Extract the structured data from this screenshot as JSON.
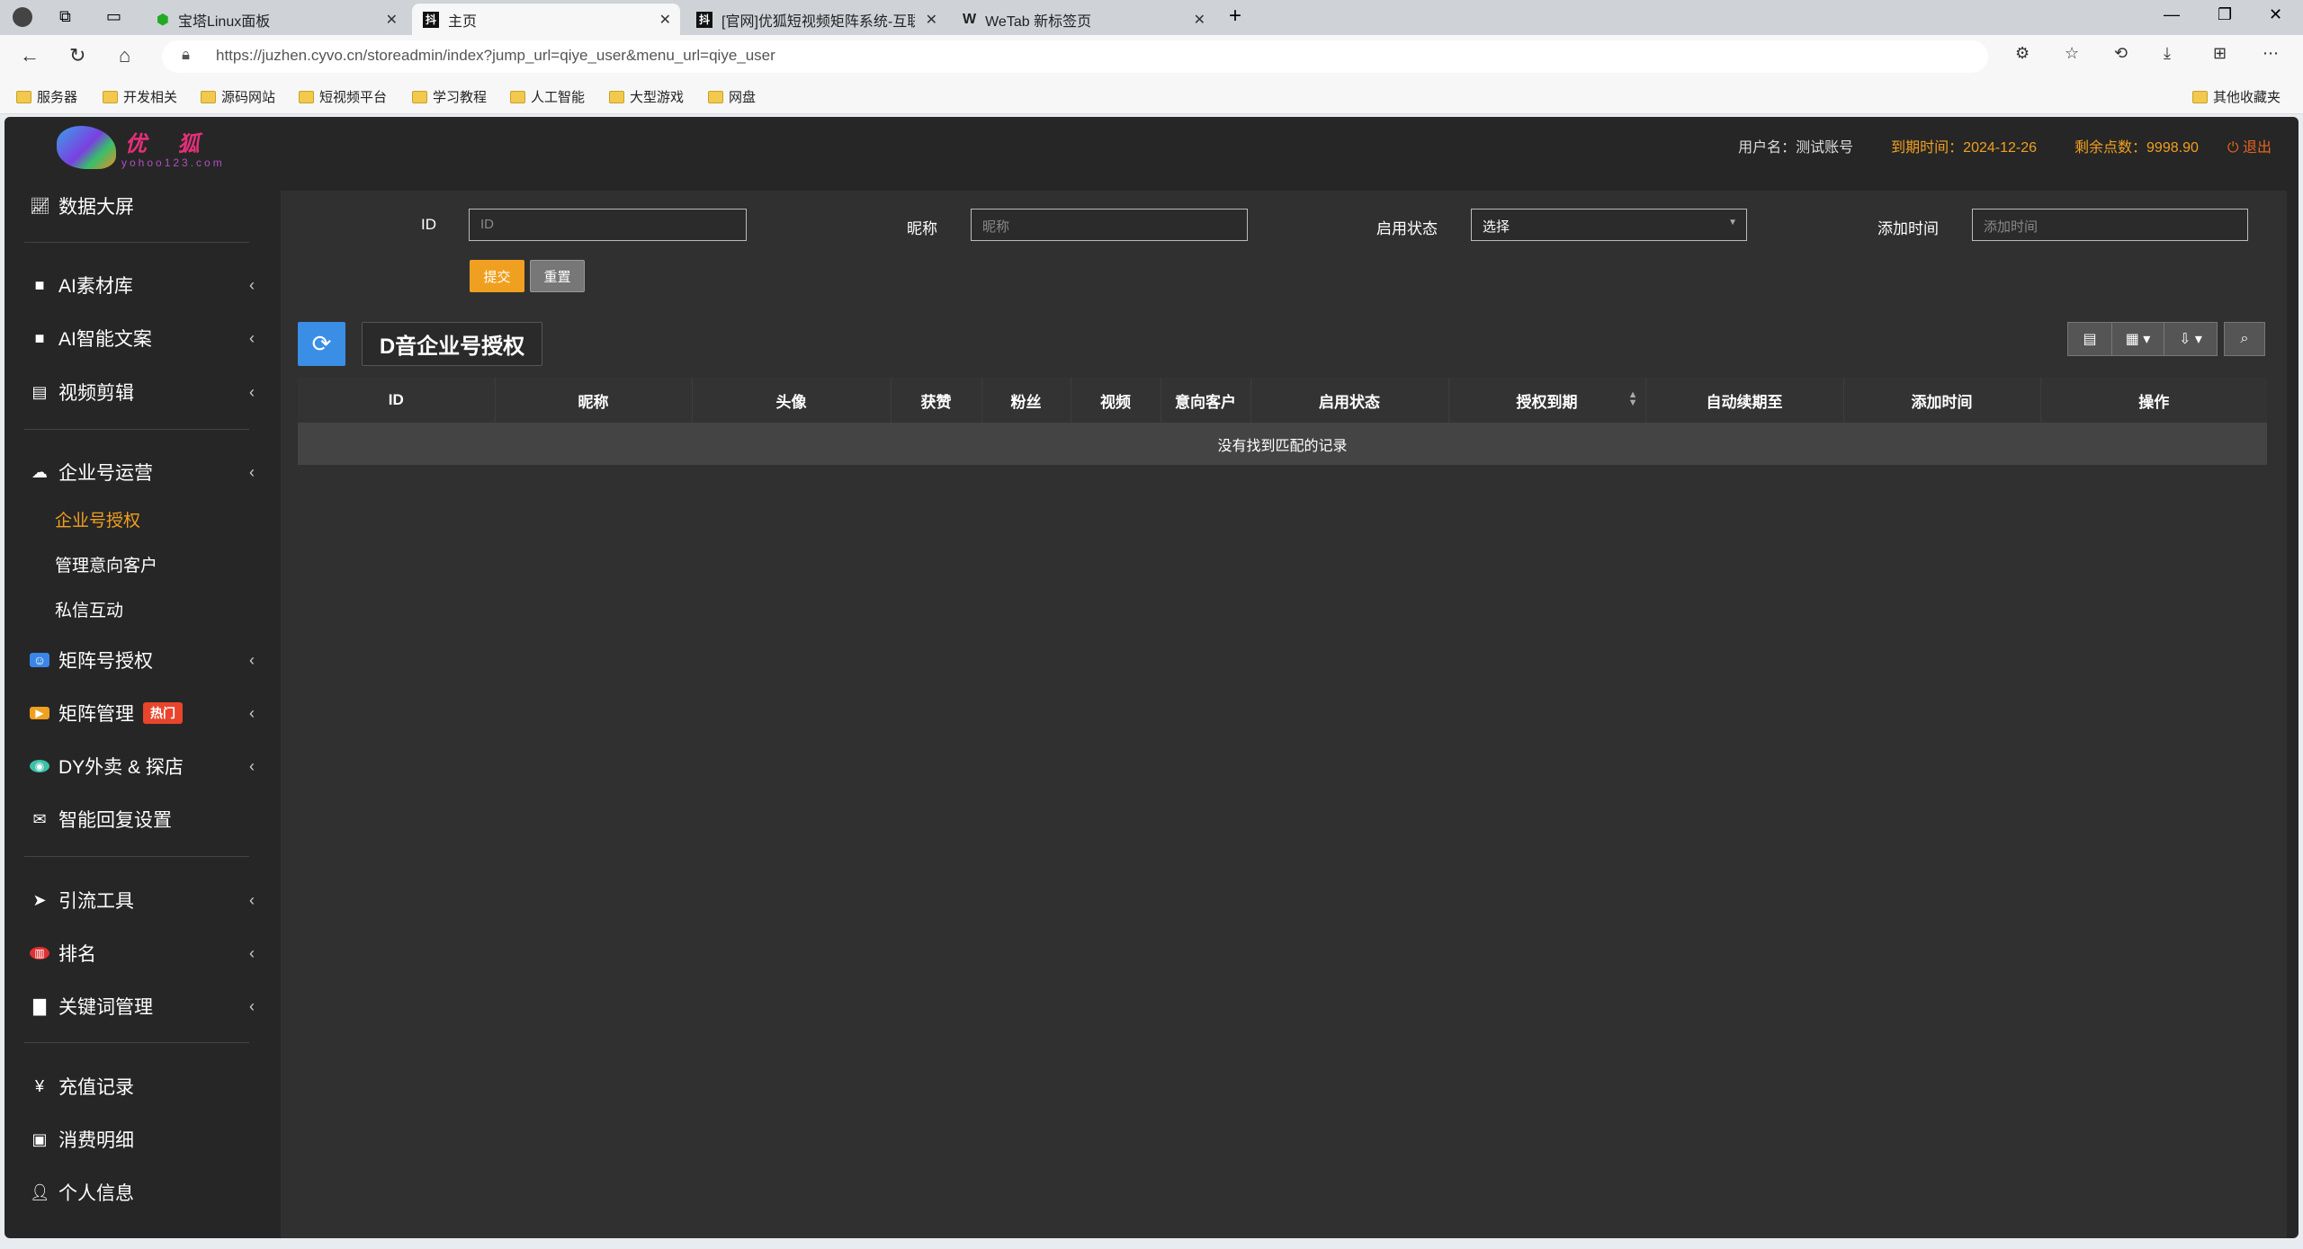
{
  "browser": {
    "tabs": [
      {
        "label": "宝塔Linux面板",
        "active": false
      },
      {
        "label": "主页",
        "active": true
      },
      {
        "label": "[官网]优狐短视频矩阵系统-互联",
        "active": false
      },
      {
        "label": "WeTab 新标签页",
        "active": false
      }
    ],
    "url": "https://juzhen.cyvo.cn/storeadmin/index?jump_url=qiye_user&menu_url=qiye_user",
    "bookmarks": [
      "服务器",
      "开发相关",
      "源码网站",
      "短视频平台",
      "学习教程",
      "人工智能",
      "大型游戏",
      "网盘"
    ],
    "other_bookmarks": "其他收藏夹"
  },
  "header": {
    "logo_text": "优 狐",
    "logo_sub": "yohoo123.com",
    "username": "用户名：测试账号",
    "expire": "到期时间：2024-12-26",
    "points": "剩余点数：9998.90",
    "logout": "退出",
    "colors": {
      "expire": "#f0a020",
      "logout": "#e8641e"
    }
  },
  "sidebar": {
    "items": [
      {
        "label": "数据大屏",
        "icon": "line-chart-icon"
      },
      {
        "label": "AI素材库",
        "icon": "folder-icon"
      },
      {
        "label": "AI智能文案",
        "icon": "folder-icon"
      },
      {
        "label": "视频剪辑",
        "icon": "film-icon"
      },
      {
        "label": "企业号运营",
        "icon": "cloud-icon"
      },
      {
        "label": "矩阵号授权",
        "icon": "user-badge-icon"
      },
      {
        "label": "矩阵管理",
        "icon": "video-icon",
        "badge": "热门"
      },
      {
        "label": "DY外卖 & 探店",
        "icon": "store-icon"
      },
      {
        "label": "智能回复设置",
        "icon": "envelope-icon"
      },
      {
        "label": "引流工具",
        "icon": "paper-plane-icon"
      },
      {
        "label": "排名",
        "icon": "rank-icon"
      },
      {
        "label": "关键词管理",
        "icon": "file-icon"
      },
      {
        "label": "充值记录",
        "icon": "yen-icon"
      },
      {
        "label": "消费明细",
        "icon": "money-icon"
      },
      {
        "label": "个人信息",
        "icon": "user-icon"
      }
    ],
    "subitems": [
      {
        "label": "企业号授权",
        "active": true
      },
      {
        "label": "管理意向客户"
      },
      {
        "label": "私信互动"
      }
    ]
  },
  "search": {
    "id_label": "ID",
    "id_placeholder": "ID",
    "nick_label": "昵称",
    "nick_placeholder": "昵称",
    "status_label": "启用状态",
    "status_value": "选择",
    "time_label": "添加时间",
    "time_placeholder": "添加时间",
    "submit": "提交",
    "reset": "重置"
  },
  "table": {
    "title": "D音企业号授权",
    "columns": [
      "ID",
      "昵称",
      "头像",
      "获赞",
      "粉丝",
      "视频",
      "意向客户",
      "启用状态",
      "授权到期",
      "自动续期至",
      "添加时间",
      "操作"
    ],
    "empty": "没有找到匹配的记录"
  }
}
